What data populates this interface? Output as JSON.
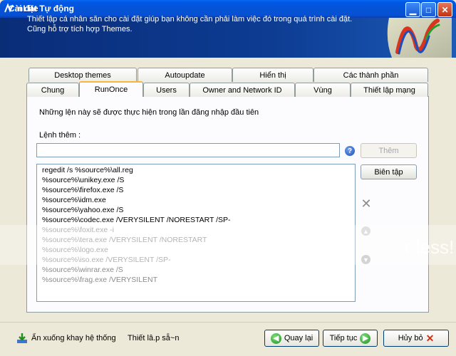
{
  "window": {
    "title": "nLite"
  },
  "header": {
    "title": "Cài đặt Tự động",
    "desc_line1": "Thiết lập cá nhân săn cho cài đặt giúp bạn không cần phải làm việc đó trong quá trình cài đặt.",
    "desc_line2": "Cũng hỗ trợ tích hợp Themes."
  },
  "tabs_row_back": [
    "Desktop themes",
    "Autoupdate",
    "Hiển thị",
    "Các thành phần"
  ],
  "tabs_row_front": [
    "Chung",
    "RunOnce",
    "Users",
    "Owner and Network ID",
    "Vùng",
    "Thiết lập mạng"
  ],
  "active_tab": "RunOnce",
  "runonce": {
    "description": "Những lện này sẽ được thực hiện trong lần đăng nhập đầu tiên",
    "command_label": "Lệnh thêm :",
    "command_value": "",
    "add_label": "Thêm",
    "edit_label": "Biên tập",
    "commands": [
      "regedit /s %source%\\all.reg",
      "%source%\\unikey.exe /S",
      "%source%\\firefox.exe /S",
      "%source%\\idm.exe",
      "%source%\\yahoo.exe /S",
      "%source%\\codec.exe /VERYSILENT /NORESTART /SP-",
      "%source%\\foxit.exe -i",
      "%source%\\tera.exe /VERYSILENT /NORESTART",
      "%source%\\logo.exe",
      "%source%\\iso.exe /VERYSILENT /SP-",
      "%source%\\winrar.exe /S",
      "%source%\\frag.exe /VERYSILENT"
    ]
  },
  "footer": {
    "minimize_label": "Ẩn xuống khay hệ thống",
    "presets_label": "Thiết lâ.p sẵ~n",
    "back_label": "Quay lại",
    "next_label": "Tiếp tục",
    "cancel_label": "Hủy bỏ"
  },
  "watermark": {
    "text": "r less!"
  },
  "icons": {
    "app": "nlite-logo-icon",
    "help": "help-icon",
    "remove": "remove-icon",
    "up": "move-up-icon",
    "down": "move-down-icon",
    "tray": "tray-download-icon",
    "back": "back-arrow-icon",
    "next": "next-arrow-icon",
    "cancel": "cancel-x-icon"
  },
  "colors": {
    "titlebar": "#0553d6",
    "banner": "#0d3c93",
    "accent_tab": "#f6b73d"
  }
}
